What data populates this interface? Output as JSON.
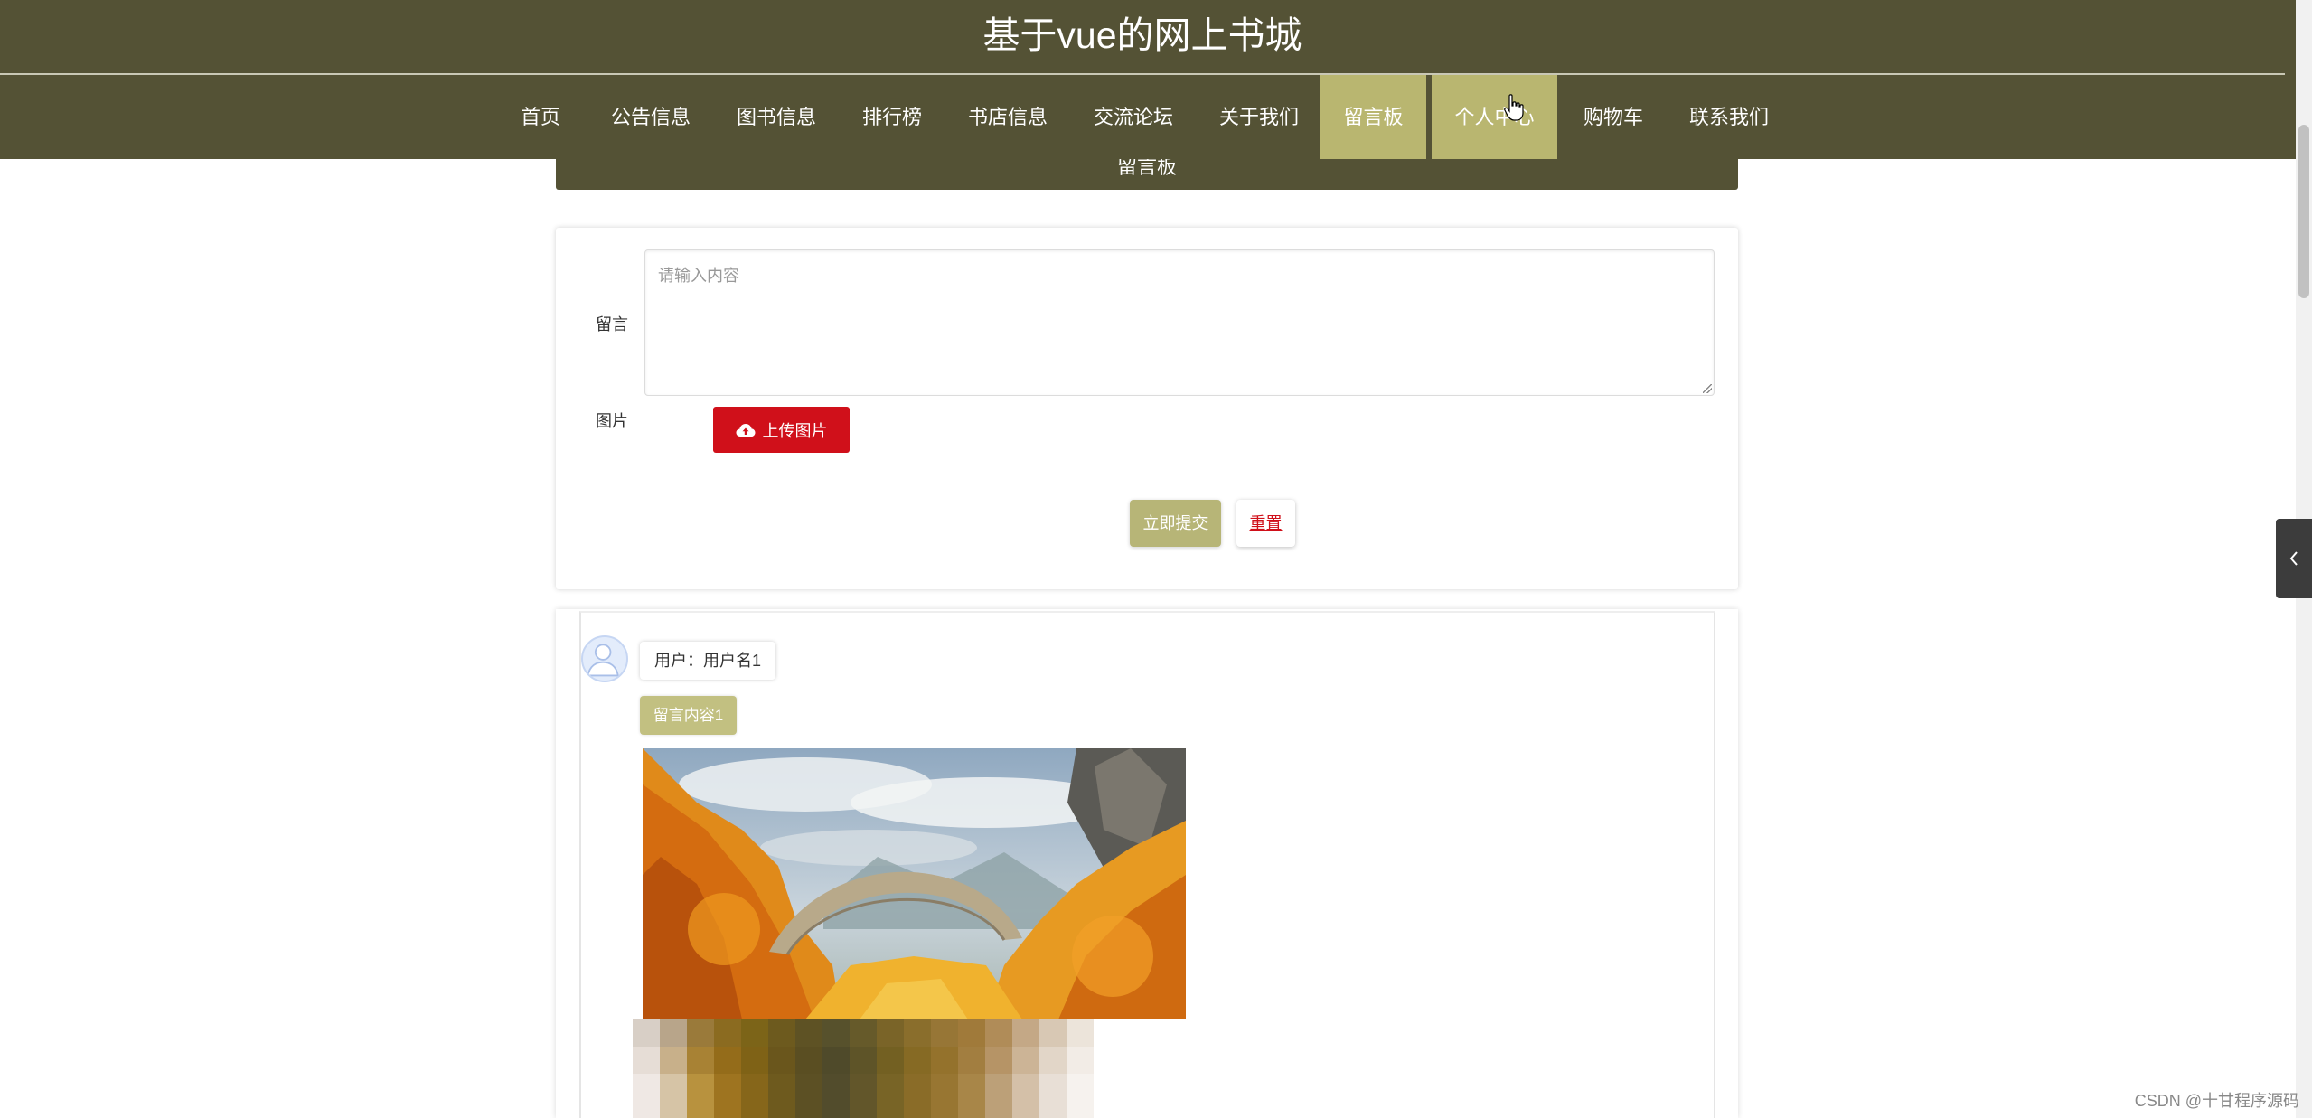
{
  "header": {
    "site_title": "基于vue的网上书城"
  },
  "nav": {
    "items": [
      {
        "label": "首页",
        "active": false
      },
      {
        "label": "公告信息",
        "active": false
      },
      {
        "label": "图书信息",
        "active": false
      },
      {
        "label": "排行榜",
        "active": false
      },
      {
        "label": "书店信息",
        "active": false
      },
      {
        "label": "交流论坛",
        "active": false
      },
      {
        "label": "关于我们",
        "active": false
      },
      {
        "label": "留言板",
        "active": true
      },
      {
        "label": "个人中心",
        "active": true
      },
      {
        "label": "购物车",
        "active": false
      },
      {
        "label": "联系我们",
        "active": false
      }
    ]
  },
  "section": {
    "title": "留言板"
  },
  "form": {
    "message_label": "留言",
    "message_placeholder": "请输入内容",
    "image_label": "图片",
    "upload_button": "上传图片",
    "submit_button": "立即提交",
    "reset_button": "重置"
  },
  "messages": [
    {
      "user": "用户：用户名1",
      "content": "留言内容1"
    }
  ],
  "side_tab": {
    "icon": "chevron-left-icon"
  },
  "watermark": "CSDN @十甘程序源码",
  "colors": {
    "header_bg": "#545235",
    "nav_active": "#b9b670",
    "upload_button": "#d0101a",
    "submit_button": "#b7b577",
    "content_tag": "#c2c081"
  }
}
